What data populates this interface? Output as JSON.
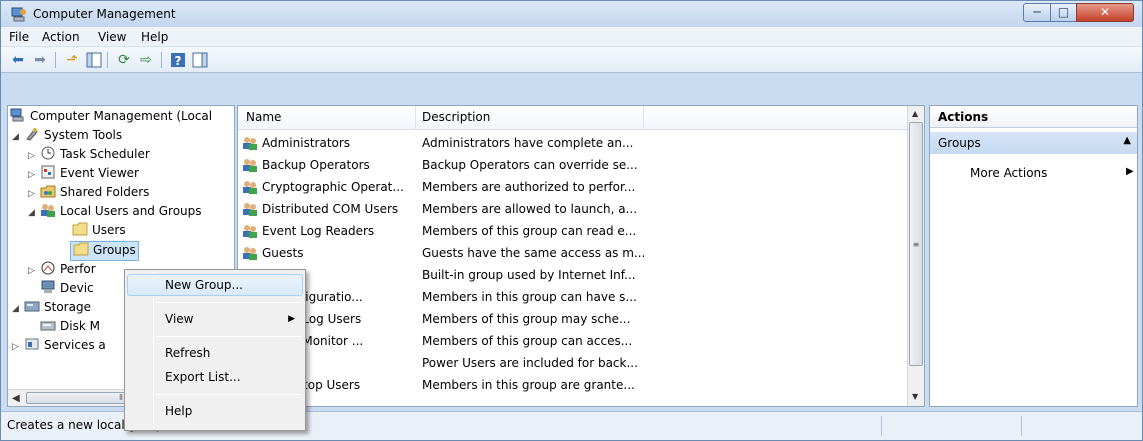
{
  "window": {
    "title": "Computer Management",
    "min_label": "─",
    "max_label": "□",
    "close_label": "✕"
  },
  "menu": [
    "File",
    "Action",
    "View",
    "Help"
  ],
  "toolbar": {
    "icons": [
      "back-arrow-icon",
      "forward-arrow-icon",
      "up-folder-icon",
      "show-hide-console-tree-icon",
      "refresh-icon",
      "export-list-icon",
      "help-icon",
      "show-hide-action-pane-icon"
    ]
  },
  "tree": [
    {
      "label": "Computer Management (Local",
      "icon": "computer-management-icon",
      "expander": ""
    },
    {
      "label": "System Tools",
      "icon": "system-tools-icon",
      "expander": "◢"
    },
    {
      "label": "Task Scheduler",
      "icon": "clock-icon",
      "expander": "▷"
    },
    {
      "label": "Event Viewer",
      "icon": "event-viewer-icon",
      "expander": "▷"
    },
    {
      "label": "Shared Folders",
      "icon": "shared-folders-icon",
      "expander": "▷"
    },
    {
      "label": "Local Users and Groups",
      "icon": "users-icon",
      "expander": "◢"
    },
    {
      "label": "Users",
      "icon": "folder-icon",
      "expander": ""
    },
    {
      "label": "Groups",
      "icon": "folder-icon",
      "expander": ""
    },
    {
      "label": "Perfor",
      "icon": "performance-icon",
      "expander": "▷"
    },
    {
      "label": "Devic",
      "icon": "device-manager-icon",
      "expander": ""
    },
    {
      "label": "Storage",
      "icon": "storage-icon",
      "expander": "◢"
    },
    {
      "label": "Disk M",
      "icon": "disk-icon",
      "expander": ""
    },
    {
      "label": "Services a",
      "icon": "services-icon",
      "expander": "▷"
    }
  ],
  "list": {
    "headers": [
      "Name",
      "Description"
    ],
    "rows": [
      {
        "name": "Administrators",
        "desc": "Administrators have complete an..."
      },
      {
        "name": "Backup Operators",
        "desc": "Backup Operators can override se..."
      },
      {
        "name": "Cryptographic Operat...",
        "desc": "Members are authorized to perfor..."
      },
      {
        "name": "Distributed COM Users",
        "desc": "Members are allowed to launch, a..."
      },
      {
        "name": "Event Log Readers",
        "desc": "Members of this group can read e..."
      },
      {
        "name": "Guests",
        "desc": "Guests have the same access as m..."
      },
      {
        "name": "RS",
        "desc": "Built-in group used by Internet Inf..."
      },
      {
        "name": "rk Configuratio...",
        "desc": "Members in this group can have s..."
      },
      {
        "name": "nance Log Users",
        "desc": "Members of this group may sche..."
      },
      {
        "name": "nance Monitor ...",
        "desc": "Members of this group can acces..."
      },
      {
        "name": "Users",
        "desc": "Power Users are included for back..."
      },
      {
        "name": "e Desktop Users",
        "desc": "Members in this group are grante..."
      }
    ]
  },
  "actions": {
    "header": "Actions",
    "section": "Groups",
    "item": "More Actions"
  },
  "context_menu": {
    "items": [
      "New Group...",
      "View",
      "Refresh",
      "Export List...",
      "Help"
    ]
  },
  "status": {
    "text": "Creates a new local group."
  },
  "colors": {
    "selection": "#cce4f7",
    "chrome": "#c9dcf2",
    "action_section": "#c5d9f1"
  }
}
